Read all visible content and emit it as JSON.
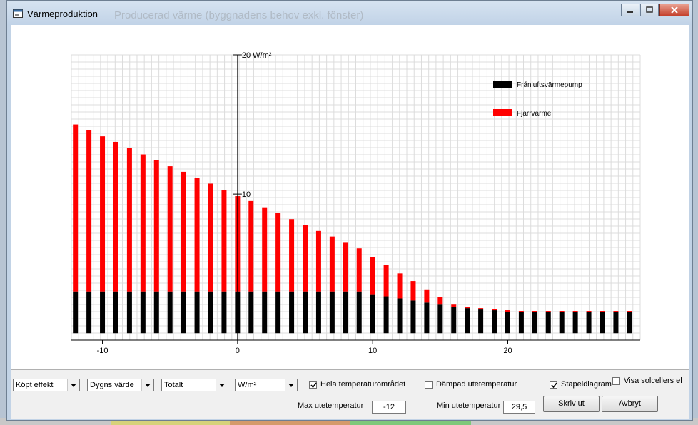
{
  "window": {
    "title": "Värmeproduktion",
    "ghost_title": "Producerad värme (byggnadens behov exkl. fönster)"
  },
  "colors": {
    "fjarrvarme": "#ff0000",
    "franluft": "#000000",
    "grid": "#dcdcdc"
  },
  "chart_data": {
    "type": "bar",
    "stacked": true,
    "x": [
      -12,
      -11,
      -10,
      -9,
      -8,
      -7,
      -6,
      -5,
      -4,
      -3,
      -2,
      -1,
      0,
      1,
      2,
      3,
      4,
      5,
      6,
      7,
      8,
      9,
      10,
      11,
      12,
      13,
      14,
      15,
      16,
      17,
      18,
      19,
      20,
      21,
      22,
      23,
      24,
      25,
      26,
      27,
      28,
      29
    ],
    "x_axis_ticks": [
      -10,
      0,
      10,
      20
    ],
    "y_axis_ticks": [
      "10",
      "20 W/m²"
    ],
    "ylim": [
      -0.5,
      20
    ],
    "xlim": [
      -12.3,
      29.8
    ],
    "grid": true,
    "legend_position": "top-right",
    "series": [
      {
        "name": "Frånluftsvärmepump",
        "color": "#000000",
        "values": [
          3,
          3,
          3,
          3,
          3,
          3,
          3,
          3,
          3,
          3,
          3,
          3,
          3,
          3,
          3,
          3,
          3,
          3,
          3,
          3,
          3,
          3,
          2.8,
          2.65,
          2.5,
          2.35,
          2.2,
          2.05,
          1.9,
          1.8,
          1.7,
          1.65,
          1.55,
          1.5,
          1.5,
          1.5,
          1.5,
          1.5,
          1.5,
          1.5,
          1.5,
          1.5
        ]
      },
      {
        "name": "Fjärrvärme",
        "color": "#ff0000",
        "values": [
          12,
          11.6,
          11.15,
          10.75,
          10.3,
          9.85,
          9.45,
          9.0,
          8.6,
          8.15,
          7.75,
          7.3,
          6.85,
          6.5,
          6.05,
          5.65,
          5.2,
          4.8,
          4.35,
          3.95,
          3.5,
          3.1,
          2.65,
          2.25,
          1.8,
          1.4,
          0.95,
          0.55,
          0.15,
          0.1,
          0.1,
          0.1,
          0.1,
          0.1,
          0.1,
          0.1,
          0.1,
          0.1,
          0.1,
          0.1,
          0.1,
          0.1
        ]
      }
    ]
  },
  "controls": {
    "select_1": "Köpt effekt",
    "select_2": "Dygns värde",
    "select_3": "Totalt",
    "select_4": "W/m²",
    "check_hela": "Hela temperaturområdet",
    "check_dampad": "Dämpad utetemperatur",
    "check_stapel": "Stapeldiagram",
    "check_visa": "Visa solcellers el",
    "max_label": "Max utetemperatur",
    "max_value": "-12",
    "min_label": "Min utetemperatur",
    "min_value": "29,5",
    "print_button": "Skriv ut",
    "cancel_button": "Avbryt"
  }
}
